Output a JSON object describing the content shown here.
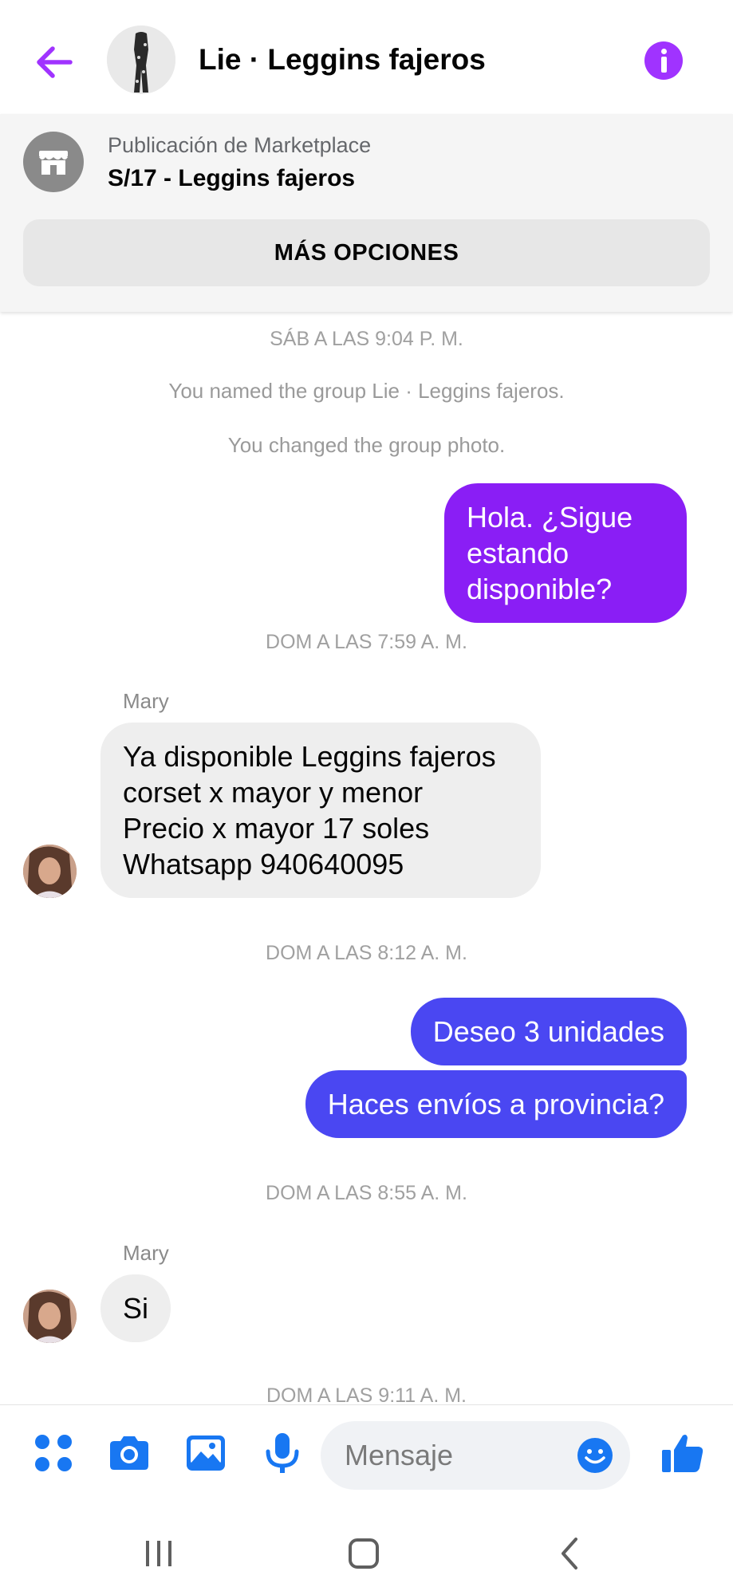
{
  "header": {
    "title": "Lie · Leggins fajeros",
    "back_icon": "arrow-left-icon",
    "info_icon": "info-icon",
    "accent_color": "#a033ff"
  },
  "marketplace": {
    "label": "Publicación de Marketplace",
    "title": "S/17 - Leggins fajeros",
    "options_label": "MÁS OPCIONES",
    "icon": "store-icon"
  },
  "messages": {
    "ts1": "SÁB A LAS 9:04 P. M.",
    "sys1": "You named the group Lie · Leggins fajeros.",
    "sys2": "You changed the group photo.",
    "out1": [
      "Hola. ¿Sigue estando",
      "disponible?"
    ],
    "ts2": "DOM A LAS 7:59 A. M.",
    "sender1": "Mary",
    "in1": [
      "Ya disponible Leggins fajeros",
      "corset x mayor y menor",
      "Precio x mayor 17 soles",
      "Whatsapp  940640095"
    ],
    "ts3": "DOM A LAS 8:12 A. M.",
    "out2": "Deseo 3 unidades",
    "out3": "Haces envíos a provincia?",
    "ts4": "DOM A LAS 8:55 A. M.",
    "sender2": "Mary",
    "in2": "Si",
    "ts5": "DOM A LAS 9:11 A. M."
  },
  "composer": {
    "placeholder": "Mensaje",
    "icons": [
      "apps-icon",
      "camera-icon",
      "image-icon",
      "microphone-icon",
      "emoji-icon",
      "thumbs-up-icon"
    ],
    "icon_color": "#1877f2"
  },
  "navbar": {
    "icons": [
      "recent-apps-icon",
      "home-icon",
      "back-icon"
    ]
  },
  "colors": {
    "out_bubble_1": "#8a1ef5",
    "out_bubble_2": "#4a47f2",
    "in_bubble": "#eeeeee"
  }
}
